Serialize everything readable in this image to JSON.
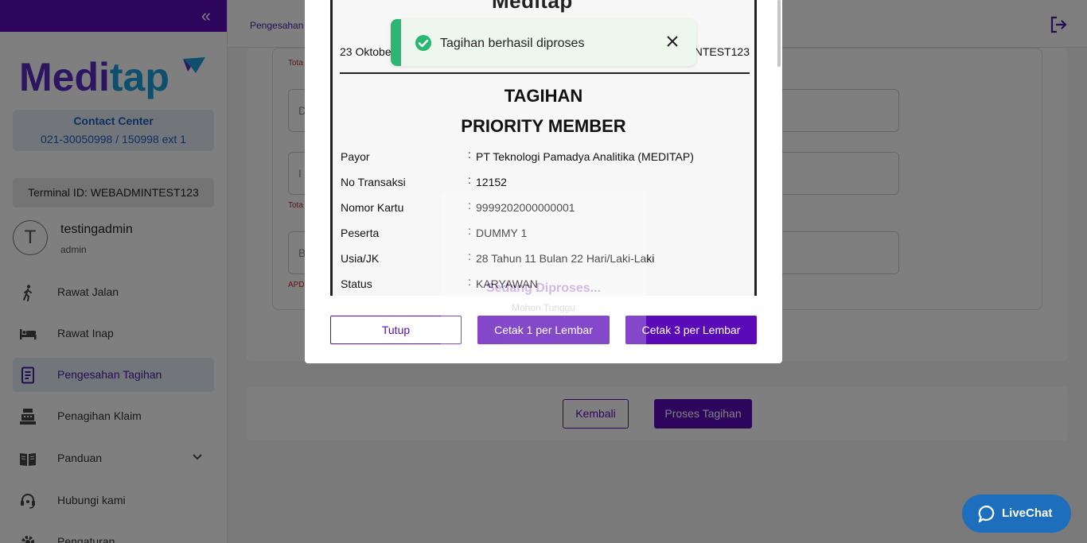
{
  "sidebar": {
    "brand": "Meditap",
    "contact_title": "Contact Center",
    "contact_phone": "021-30050998 / 150998 ext 1",
    "terminal": "Terminal ID: WEBADMINTEST123",
    "avatar_initial": "T",
    "username": "testingadmin",
    "role": "admin",
    "items": [
      {
        "label": "Rawat Jalan",
        "icon": "walk-icon"
      },
      {
        "label": "Rawat Inap",
        "icon": "bed-icon"
      },
      {
        "label": "Pengesahan Tagihan",
        "icon": "receipt-icon",
        "active": true
      },
      {
        "label": "Penagihan Klaim",
        "icon": "cash-register-icon"
      },
      {
        "label": "Panduan",
        "icon": "book-icon"
      },
      {
        "label": "Hubungi kami",
        "icon": "headset-icon"
      },
      {
        "label": "Pengaturan",
        "icon": "gear-icon"
      }
    ]
  },
  "header": {
    "breadcrumb": "Pengesahan T"
  },
  "background": {
    "total_label_1": "Tota",
    "field_2_placeholder": "D",
    "field_3_placeholder": "I",
    "total_label_2": "Tota",
    "field_4_placeholder": "B",
    "apd_label": "APD",
    "back_button": "Kembali",
    "process_button": "Proses Tagihan"
  },
  "loading": {
    "title": "Sedang Diproses...",
    "subtitle": "Mohon Tunggu"
  },
  "modal": {
    "logo": "Meditap",
    "date": "23 Oktobe",
    "terminal": "NTEST123",
    "title": "TAGIHAN",
    "subtitle": "PRIORITY MEMBER",
    "rows": [
      {
        "label": "Payor",
        "value": "PT Teknologi Pamadya Analitika (MEDITAP)"
      },
      {
        "label": "No Transaksi",
        "value": "12152"
      },
      {
        "label": "Nomor Kartu",
        "value": "9999202000000001"
      },
      {
        "label": "Peserta",
        "value": "DUMMY 1"
      },
      {
        "label": "Usia/JK",
        "value": "28 Tahun 11 Bulan 22 Hari/Laki-Laki"
      },
      {
        "label": "Status",
        "value": "KARYAWAN"
      }
    ],
    "separator": ":",
    "close_button": "Tutup",
    "print1_button": "Cetak 1 per Lembar",
    "print3_button": "Cetak 3 per Lembar"
  },
  "toast": {
    "message": "Tagihan berhasil diproses",
    "status_color": "#2bb673"
  },
  "livechat": {
    "label": "LiveChat"
  },
  "colors": {
    "brand": "#5b0ab8",
    "contact": "#1f5fc4",
    "livechat": "#1d6fbe"
  }
}
